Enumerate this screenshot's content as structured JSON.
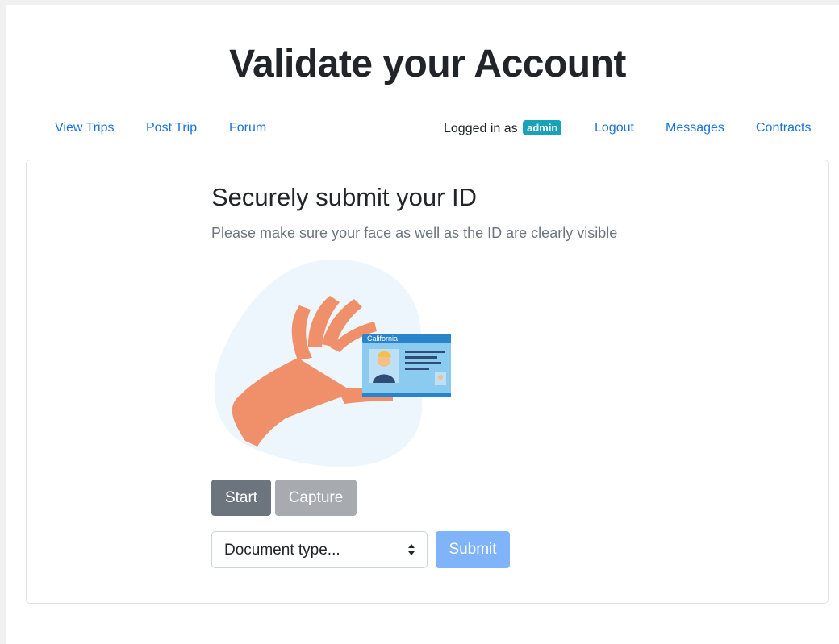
{
  "page": {
    "title": "Validate your Account"
  },
  "nav": {
    "view_trips": "View Trips",
    "post_trip": "Post Trip",
    "forum": "Forum",
    "logged_in_prefix": "Logged in as",
    "username": "admin",
    "logout": "Logout",
    "messages": "Messages",
    "contracts": "Contracts"
  },
  "card": {
    "title": "Securely submit your ID",
    "subtitle": "Please make sure your face as well as the ID are clearly visible",
    "id_card_state": "California"
  },
  "buttons": {
    "start": "Start",
    "capture": "Capture",
    "submit": "Submit"
  },
  "document_select": {
    "selected": "Document type..."
  },
  "colors": {
    "link": "#1a73d9",
    "badge": "#17a2b8",
    "start_button": "#6c757d",
    "capture_button": "#a7abaf",
    "submit_button": "#7fb4fb",
    "hand": "#f0906a",
    "card_blue": "#8ccbf0"
  }
}
